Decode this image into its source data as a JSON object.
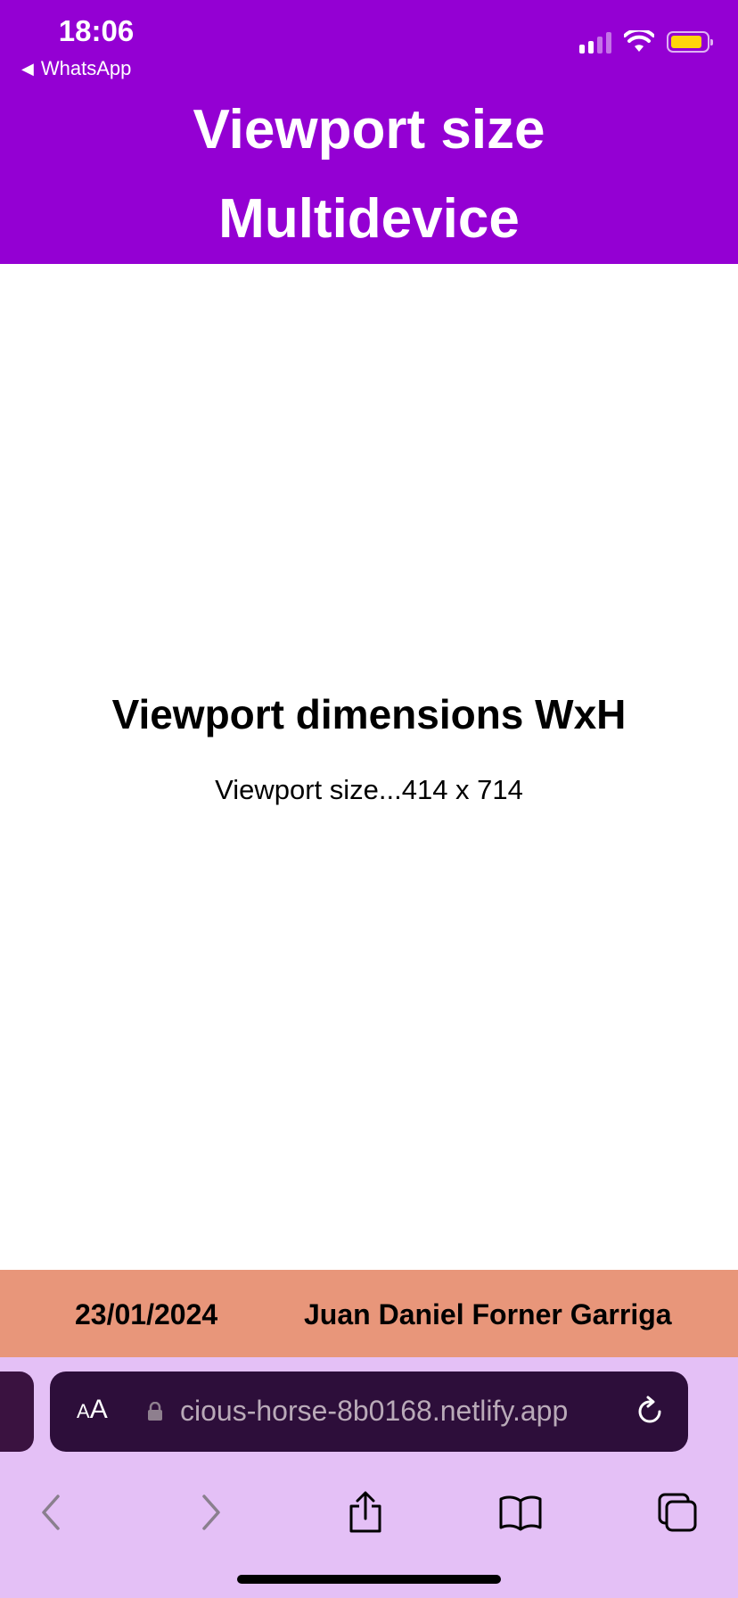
{
  "status_bar": {
    "time": "18:06",
    "back_app": "WhatsApp",
    "battery_color": "#ffd60a"
  },
  "header": {
    "title_line1": "Viewport size",
    "title_line2": "Multidevice",
    "background": "#9400d3"
  },
  "main": {
    "heading": "Viewport dimensions WxH",
    "size_text": "Viewport size...414 x 714"
  },
  "footer": {
    "date": "23/01/2024",
    "author": "Juan Daniel Forner Garriga",
    "background": "#e8967a"
  },
  "browser": {
    "aa_label_small": "A",
    "aa_label_large": "A",
    "url": "cious-horse-8b0168.netlify.app",
    "icons": [
      "lock-icon",
      "reload-icon",
      "back-arrow-icon",
      "forward-arrow-icon",
      "share-icon",
      "bookmarks-icon",
      "tabs-icon"
    ]
  }
}
